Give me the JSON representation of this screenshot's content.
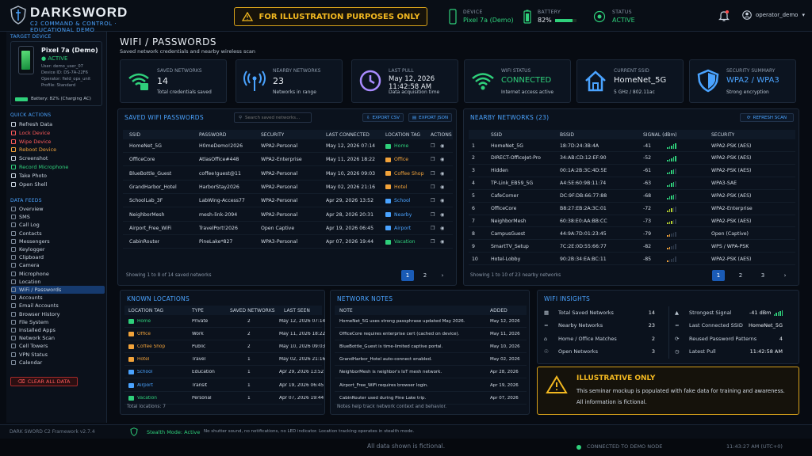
{
  "header": {
    "brand": "DARKSWORD",
    "brand_sub": "C2 COMMAND & CONTROL · EDUCATIONAL DEMO",
    "banner": "FOR ILLUSTRATION PURPOSES ONLY",
    "device_label": "DEVICE",
    "device_value": "Pixel 7a (Demo)",
    "battery_label": "BATTERY",
    "battery_value": "82%",
    "battery_level": 0.82,
    "status_label": "STATUS",
    "status_value": "ACTIVE",
    "user": "operator_demo"
  },
  "sidebar": {
    "target_label": "TARGET DEVICE",
    "device_name": "Pixel 7a (Demo)",
    "device_state": "ACTIVE",
    "meta": [
      "User: demo_user_07",
      "Device ID: DS-7A-22F6",
      "Operator: field_ops_unit",
      "Profile: Standard"
    ],
    "battery": "Battery: 82% (Charging AC)",
    "quick_label": "QUICK ACTIONS",
    "quick_actions": [
      {
        "label": "Refresh Data",
        "color": "#c9d3df"
      },
      {
        "label": "Lock Device",
        "color": "#ff5a5a"
      },
      {
        "label": "Wipe Device",
        "color": "#ff5a5a"
      },
      {
        "label": "Reboot Device",
        "color": "#f2a33a"
      },
      {
        "label": "Screenshot",
        "color": "#c9d3df"
      },
      {
        "label": "Record Microphone",
        "color": "#2fd07b"
      },
      {
        "label": "Take Photo",
        "color": "#c9d3df"
      },
      {
        "label": "Open Shell",
        "color": "#c9d3df"
      }
    ],
    "feeds_label": "DATA FEEDS",
    "feeds": [
      "Overview",
      "SMS",
      "Call Log",
      "Contacts",
      "Messengers",
      "Keylogger",
      "Clipboard",
      "Camera",
      "Microphone",
      "Location",
      "WiFi / Passwords",
      "Accounts",
      "Email Accounts",
      "Browser History",
      "File System",
      "Installed Apps",
      "Network Scan",
      "Cell Towers",
      "VPN Status",
      "Calendar"
    ],
    "active_feed": 10,
    "clear_all": "CLEAR ALL DATA"
  },
  "page": {
    "title": "WIFI / PASSWORDS",
    "subtitle": "Saved network credentials and nearby wireless scan"
  },
  "stats": [
    {
      "label": "SAVED NETWORKS",
      "value": "14",
      "sub": "Total credentials saved",
      "icon": "wifi-lock-icon",
      "color": "#2fd07b"
    },
    {
      "label": "NEARBY NETWORKS",
      "value": "23",
      "sub": "Networks in range",
      "icon": "antenna-icon",
      "color": "#4aa3ff"
    },
    {
      "label": "LAST PULL",
      "value": "May 12, 2026",
      "value2": "11:42:58 AM",
      "sub": "Data acquisition time",
      "icon": "clock-icon",
      "color": "#a98bff"
    },
    {
      "label": "WIFI STATUS",
      "value": "CONNECTED",
      "sub": "Internet access active",
      "icon": "wifi-icon",
      "color": "#2fd07b"
    },
    {
      "label": "CURRENT SSID",
      "value": "HomeNet_5G",
      "sub": "5 GHz / 802.11ac",
      "icon": "home-icon",
      "color": "#4aa3ff"
    },
    {
      "label": "SECURITY SUMMARY",
      "value": "WPA2 / WPA3",
      "sub": "Strong encryption",
      "icon": "shield-icon",
      "color": "#4aa3ff"
    }
  ],
  "saved": {
    "title": "SAVED WIFI PASSWORDS",
    "search_placeholder": "Search saved networks...",
    "export_csv": "EXPORT CSV",
    "export_json": "EXPORT JSON",
    "columns": [
      "SSID",
      "PASSWORD",
      "SECURITY",
      "LAST CONNECTED",
      "LOCATION TAG",
      "ACTIONS"
    ],
    "rows": [
      {
        "ssid": "HomeNet_5G",
        "password": "H0meDemo!2026",
        "security": "WPA2-Personal",
        "last": "May 12, 2026 07:14",
        "tag": "Home",
        "tag_color": "#2fd07b"
      },
      {
        "ssid": "OfficeCore",
        "password": "AtlasOffice#448",
        "security": "WPA2-Enterprise",
        "last": "May 11, 2026 18:22",
        "tag": "Office",
        "tag_color": "#f2a33a"
      },
      {
        "ssid": "BlueBottle_Guest",
        "password": "coffee!guest@11",
        "security": "WPA2-Personal",
        "last": "May 10, 2026 09:03",
        "tag": "Coffee Shop",
        "tag_color": "#f2a33a"
      },
      {
        "ssid": "GrandHarbor_Hotel",
        "password": "HarborStay2026",
        "security": "WPA2-Personal",
        "last": "May 02, 2026 21:16",
        "tag": "Hotel",
        "tag_color": "#f2a33a"
      },
      {
        "ssid": "SchoolLab_3F",
        "password": "LabWing-Access77",
        "security": "WPA2-Personal",
        "last": "Apr 29, 2026 13:52",
        "tag": "School",
        "tag_color": "#4aa3ff"
      },
      {
        "ssid": "NeighborMesh",
        "password": "mesh-link-2094",
        "security": "WPA2-Personal",
        "last": "Apr 28, 2026 20:31",
        "tag": "Nearby",
        "tag_color": "#4aa3ff"
      },
      {
        "ssid": "Airport_Free_WiFi",
        "password": "TravelPort!2026",
        "security": "Open Captive",
        "last": "Apr 19, 2026 06:45",
        "tag": "Airport",
        "tag_color": "#4aa3ff"
      },
      {
        "ssid": "CabinRouter",
        "password": "PineLake*827",
        "security": "WPA3-Personal",
        "last": "Apr 07, 2026 19:44",
        "tag": "Vacation",
        "tag_color": "#2fd07b"
      }
    ],
    "footer": "Showing 1 to 8 of 14 saved networks",
    "pages": [
      "1",
      "2",
      "›"
    ]
  },
  "nearby": {
    "title": "NEARBY NETWORKS (23)",
    "refresh": "REFRESH SCAN",
    "columns": [
      "SSID",
      "BSSID",
      "SIGNAL (dBm)",
      "SECURITY"
    ],
    "rows": [
      {
        "n": "1",
        "ssid": "HomeNet_5G",
        "bssid": "18:7D:24:3B:4A",
        "dbm": "-41",
        "bars": 5,
        "sec": "WPA2-PSK (AES)"
      },
      {
        "n": "2",
        "ssid": "DIRECT-OfficeJet-Pro",
        "bssid": "34:AB:CD:12:EF:90",
        "dbm": "-52",
        "bars": 5,
        "sec": "WPA2-PSK (AES)"
      },
      {
        "n": "3",
        "ssid": "Hidden",
        "bssid": "00:1A:2B:3C:4D:5E",
        "dbm": "-61",
        "bars": 4,
        "sec": "WPA2-PSK (AES)"
      },
      {
        "n": "4",
        "ssid": "TP-Link_EB59_5G",
        "bssid": "A4:5E:60:9B:11:74",
        "dbm": "-63",
        "bars": 4,
        "sec": "WPA3-SAE"
      },
      {
        "n": "5",
        "ssid": "CafeCorner",
        "bssid": "DC:9F:DB:66:77:88",
        "dbm": "-68",
        "bars": 4,
        "sec": "WPA2-PSK (AES)"
      },
      {
        "n": "6",
        "ssid": "OfficeCore",
        "bssid": "B8:27:EB:2A:3C:01",
        "dbm": "-72",
        "bars": 3,
        "sec": "WPA2-Enterprise"
      },
      {
        "n": "7",
        "ssid": "NeighborMesh",
        "bssid": "60:38:E0:AA:BB:CC",
        "dbm": "-73",
        "bars": 3,
        "sec": "WPA2-PSK (AES)"
      },
      {
        "n": "8",
        "ssid": "CampusGuest",
        "bssid": "44:9A:7D:01:23:45",
        "dbm": "-79",
        "bars": 2,
        "sec": "Open (Captive)"
      },
      {
        "n": "9",
        "ssid": "SmartTV_Setup",
        "bssid": "7C:2E:0D:55:66:77",
        "dbm": "-82",
        "bars": 2,
        "sec": "WPS / WPA-PSK"
      },
      {
        "n": "10",
        "ssid": "Hotel-Lobby",
        "bssid": "90:2B:34:EA:BC:11",
        "dbm": "-85",
        "bars": 1,
        "sec": "WPA2-PSK (AES)"
      }
    ],
    "footer": "Showing 1 to 10 of 23 nearby networks",
    "pages": [
      "1",
      "2",
      "3",
      "›"
    ]
  },
  "locations": {
    "title": "KNOWN LOCATIONS",
    "columns": [
      "LOCATION TAG",
      "TYPE",
      "SAVED NETWORKS",
      "LAST SEEN"
    ],
    "rows": [
      {
        "tag": "Home",
        "color": "#2fd07b",
        "type": "Private",
        "count": "2",
        "seen": "May 12, 2026 07:14"
      },
      {
        "tag": "Office",
        "color": "#f2a33a",
        "type": "Work",
        "count": "2",
        "seen": "May 11, 2026 18:22"
      },
      {
        "tag": "Coffee Shop",
        "color": "#f2a33a",
        "type": "Public",
        "count": "2",
        "seen": "May 10, 2026 09:03"
      },
      {
        "tag": "Hotel",
        "color": "#f2a33a",
        "type": "Travel",
        "count": "1",
        "seen": "May 02, 2026 21:16"
      },
      {
        "tag": "School",
        "color": "#4aa3ff",
        "type": "Education",
        "count": "1",
        "seen": "Apr 29, 2026 13:52"
      },
      {
        "tag": "Airport",
        "color": "#4aa3ff",
        "type": "Transit",
        "count": "1",
        "seen": "Apr 19, 2026 06:45"
      },
      {
        "tag": "Vacation",
        "color": "#2fd07b",
        "type": "Personal",
        "count": "1",
        "seen": "Apr 07, 2026 19:44"
      }
    ],
    "footer": "Total locations: 7"
  },
  "notes": {
    "title": "NETWORK NOTES",
    "columns": [
      "NOTE",
      "ADDED"
    ],
    "rows": [
      {
        "note": "HomeNet_5G uses strong passphrase updated May 2026.",
        "added": "May 12, 2026"
      },
      {
        "note": "OfficeCore requires enterprise cert (cached on device).",
        "added": "May 11, 2026"
      },
      {
        "note": "BlueBottle_Guest is time-limited captive portal.",
        "added": "May 10, 2026"
      },
      {
        "note": "GrandHarbor_Hotel auto-connect enabled.",
        "added": "May 02, 2026"
      },
      {
        "note": "NeighborMesh is neighbor's IoT mesh network.",
        "added": "Apr 28, 2026"
      },
      {
        "note": "Airport_Free_WiFi requires browser login.",
        "added": "Apr 19, 2026"
      },
      {
        "note": "CabinRouter used during Pine Lake trip.",
        "added": "Apr 07, 2026"
      }
    ],
    "footer": "Notes help track network context and behavior."
  },
  "insights": {
    "title": "WIFI INSIGHTS",
    "left": [
      {
        "label": "Total Saved Networks",
        "value": "14"
      },
      {
        "label": "Nearby Networks",
        "value": "23"
      },
      {
        "label": "Home / Office Matches",
        "value": "2"
      },
      {
        "label": "Open Networks",
        "value": "3"
      }
    ],
    "right": [
      {
        "label": "Strongest Signal",
        "value": "-41 dBm"
      },
      {
        "label": "Last Connected SSID",
        "value": "HomeNet_5G"
      },
      {
        "label": "Reused Password Patterns",
        "value": "4"
      },
      {
        "label": "Latest Pull",
        "value": "11:42:58 AM"
      }
    ]
  },
  "alert": {
    "title": "ILLUSTRATIVE ONLY",
    "line1": "This seminar mockup is populated with fake data for training and awareness.",
    "line2": "All information is fictional."
  },
  "footer": {
    "version": "DARK SWORD C2 Framework v2.7.4",
    "stealth": "Stealth Mode: Active",
    "stealth_desc": "No shutter sound, no notifications, no LED indicator. Location tracking operates in stealth mode.",
    "fictional": "All data shown is fictional.",
    "connection": "CONNECTED TO DEMO NODE",
    "clock": "11:43:27 AM (UTC+0)"
  }
}
